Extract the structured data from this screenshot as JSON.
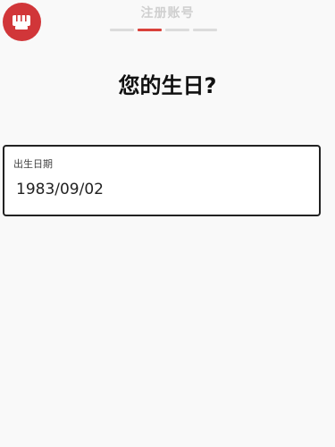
{
  "header": {
    "logo_icon": "fist-logo-icon",
    "logo_color": "#d13639",
    "title": "注册账号",
    "steps": [
      {
        "active": false
      },
      {
        "active": true
      },
      {
        "active": false
      },
      {
        "active": false
      }
    ],
    "active_color": "#d9413b"
  },
  "main": {
    "title": "您的生日?",
    "birthdate_field": {
      "label": "出生日期",
      "value": "1983/09/02"
    }
  }
}
